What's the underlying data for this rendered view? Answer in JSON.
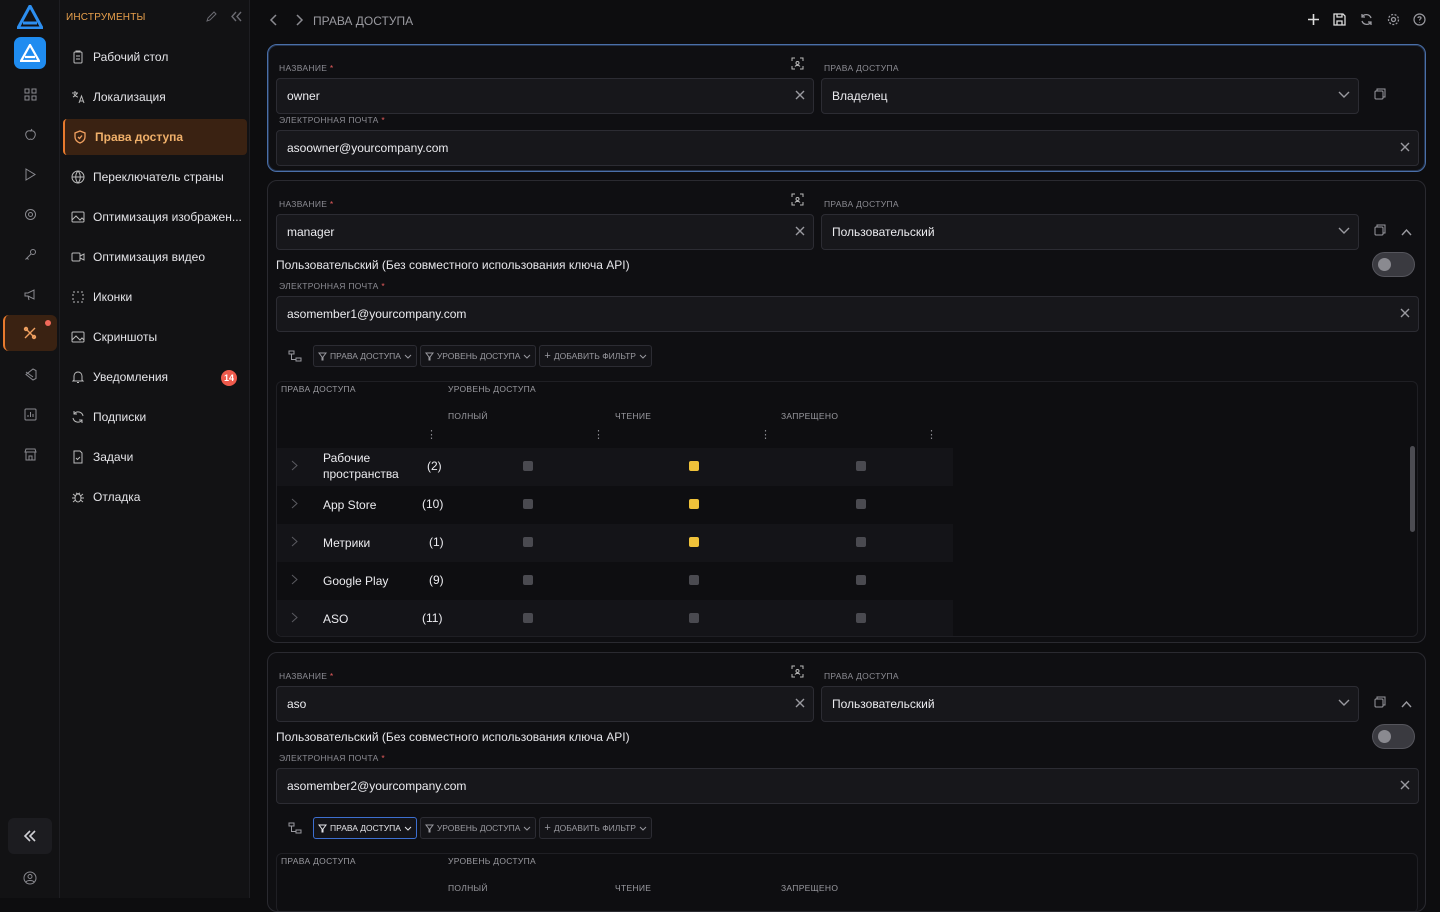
{
  "sidebar": {
    "header": "ИНСТРУМЕНТЫ",
    "items": [
      {
        "label": "Рабочий стол",
        "icon": "clipboard-icon"
      },
      {
        "label": "Локализация",
        "icon": "translate-icon"
      },
      {
        "label": "Права доступа",
        "icon": "shield-icon",
        "selected": true
      },
      {
        "label": "Переключатель страны",
        "icon": "globe-icon"
      },
      {
        "label": "Оптимизация изображен...",
        "icon": "image-icon"
      },
      {
        "label": "Оптимизация видео",
        "icon": "video-icon"
      },
      {
        "label": "Иконки",
        "icon": "dashed-square-icon"
      },
      {
        "label": "Скриншоты",
        "icon": "screenshot-icon"
      },
      {
        "label": "Уведомления",
        "icon": "bell-icon",
        "badge": "14"
      },
      {
        "label": "Подписки",
        "icon": "refresh-icon"
      },
      {
        "label": "Задачи",
        "icon": "task-icon"
      },
      {
        "label": "Отладка",
        "icon": "bug-icon"
      }
    ]
  },
  "topbar": {
    "breadcrumb": "ПРАВА ДОСТУПА"
  },
  "labels": {
    "name": "НАЗВАНИЕ",
    "access": "ПРАВА ДОСТУПА",
    "email": "ЭЛЕКТРОННАЯ ПОЧТА",
    "required": "*",
    "toggle_desc": "Пользовательский (Без совместного использования ключа API)"
  },
  "filters": {
    "access": "ПРАВА ДОСТУПА",
    "level": "УРОВЕНЬ ДОСТУПА",
    "add": "ДОБАВИТЬ ФИЛЬТР"
  },
  "table_headers": {
    "access": "ПРАВА ДОСТУПА",
    "level": "УРОВЕНЬ ДОСТУПА",
    "full": "ПОЛНЫЙ",
    "read": "ЧТЕНИЕ",
    "forbidden": "ЗАПРЕЩЕНО"
  },
  "users": [
    {
      "name": "owner",
      "role": "Владелец",
      "email": "asoowner@yourcompany.com"
    },
    {
      "name": "manager",
      "role": "Пользовательский",
      "email": "asomember1@yourcompany.com",
      "rows": [
        {
          "name1": "Рабочие",
          "name2": "пространства",
          "count": "(2)",
          "level": "read"
        },
        {
          "name1": "App Store",
          "count": "(10)",
          "level": "read"
        },
        {
          "name1": "Метрики",
          "count": "(1)",
          "level": "read"
        },
        {
          "name1": "Google Play",
          "count": "(9)",
          "level": "none"
        },
        {
          "name1": "ASO",
          "count": "(11)",
          "level": "none"
        }
      ]
    },
    {
      "name": "aso",
      "role": "Пользовательский",
      "email": "asomember2@yourcompany.com"
    }
  ],
  "colors": {
    "accent": "#e77a2e",
    "checked": "#f0c23a",
    "badge": "#ee5a4c",
    "highlight_border": "#4a6fa8"
  }
}
